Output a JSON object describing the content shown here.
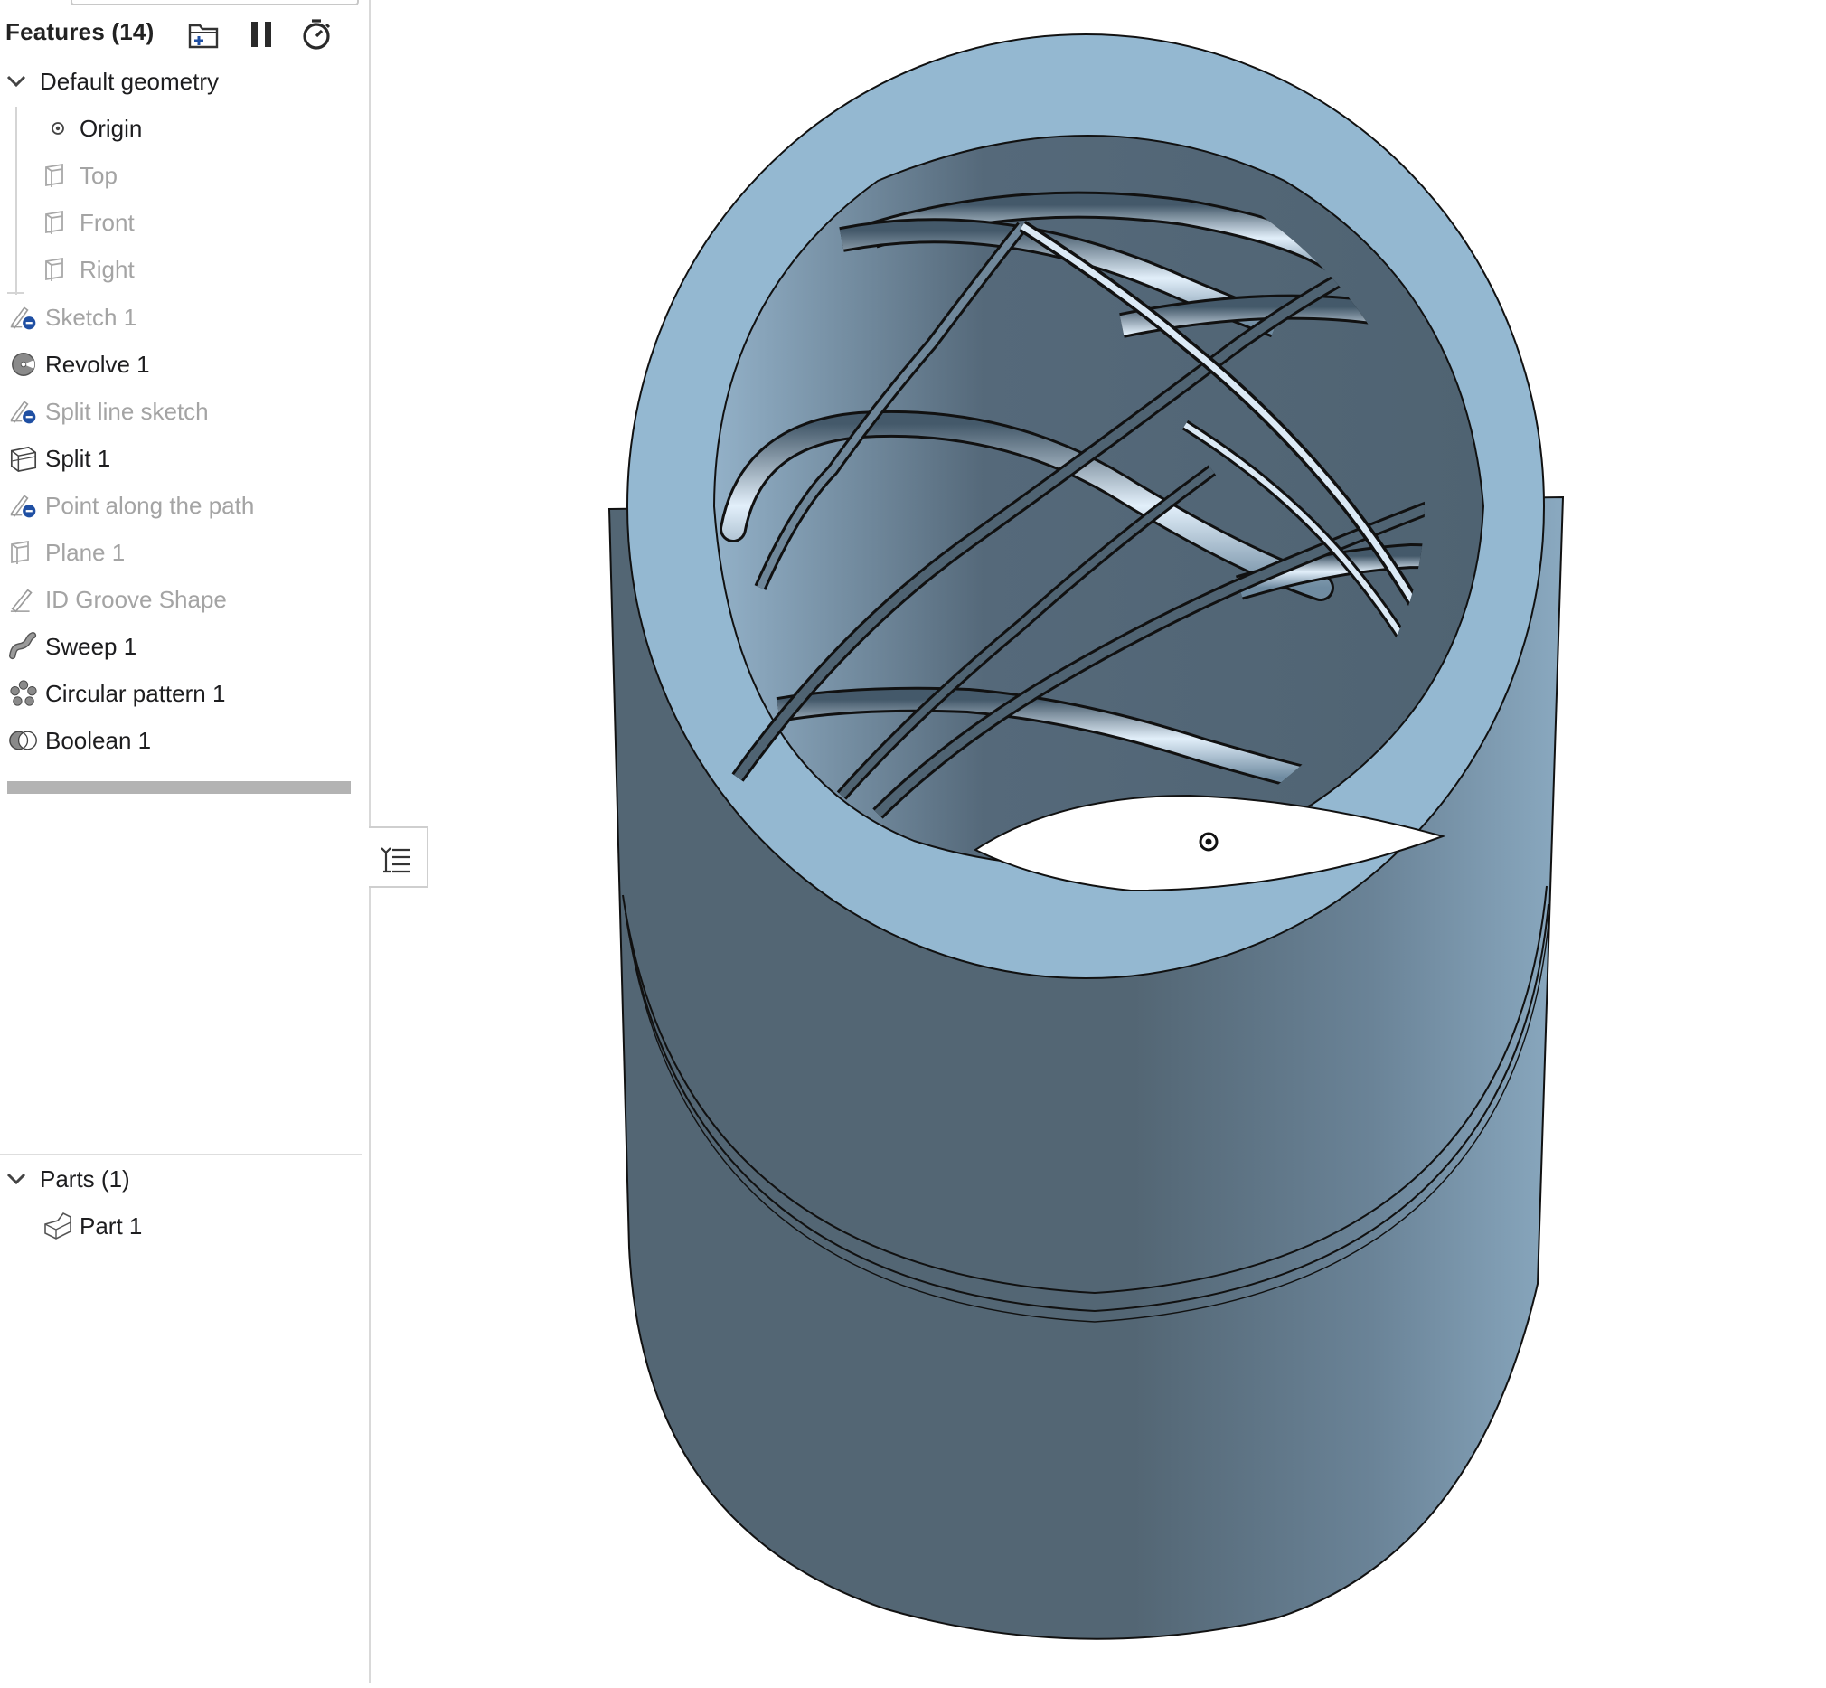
{
  "window": {
    "title": "Features (14)"
  },
  "header": {
    "title": "Features (14)",
    "icons": [
      "add-folder-icon",
      "pause-icon",
      "timer-icon"
    ]
  },
  "tree": {
    "default_geometry": {
      "label": "Default geometry",
      "expanded": true,
      "items": [
        {
          "label": "Origin",
          "icon": "origin-icon",
          "dimmed": false
        },
        {
          "label": "Top",
          "icon": "plane-icon",
          "dimmed": true
        },
        {
          "label": "Front",
          "icon": "plane-icon",
          "dimmed": true
        },
        {
          "label": "Right",
          "icon": "plane-icon",
          "dimmed": true
        }
      ]
    },
    "features": [
      {
        "label": "Sketch 1",
        "icon": "sketch-hidden-icon",
        "dimmed": true
      },
      {
        "label": "Revolve 1",
        "icon": "revolve-icon",
        "dimmed": false
      },
      {
        "label": "Split line sketch",
        "icon": "sketch-hidden-icon",
        "dimmed": true
      },
      {
        "label": "Split 1",
        "icon": "split-icon",
        "dimmed": false
      },
      {
        "label": "Point along the path",
        "icon": "sketch-hidden-icon",
        "dimmed": true
      },
      {
        "label": "Plane 1",
        "icon": "plane-icon",
        "dimmed": true
      },
      {
        "label": "ID Groove Shape",
        "icon": "sketch-icon",
        "dimmed": true
      },
      {
        "label": "Sweep 1",
        "icon": "sweep-icon",
        "dimmed": false
      },
      {
        "label": "Circular pattern 1",
        "icon": "circular-pattern-icon",
        "dimmed": false
      },
      {
        "label": "Boolean 1",
        "icon": "boolean-icon",
        "dimmed": false
      }
    ]
  },
  "parts": {
    "label": "Parts (1)",
    "expanded": true,
    "items": [
      {
        "label": "Part 1",
        "icon": "part-icon"
      }
    ]
  },
  "colors": {
    "part_face_dark": "#536674",
    "part_face_light": "#7f9fb6",
    "part_top": "#94b8d1",
    "groove_highlight": "#d6e8f6",
    "accent_blue": "#1f4fa3"
  }
}
